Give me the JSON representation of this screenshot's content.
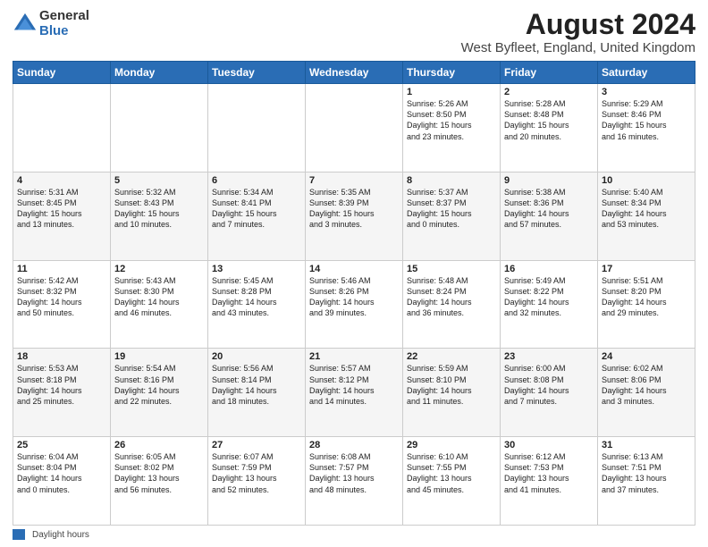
{
  "logo": {
    "general": "General",
    "blue": "Blue"
  },
  "title": "August 2024",
  "subtitle": "West Byfleet, England, United Kingdom",
  "footer": {
    "legend_label": "Daylight hours"
  },
  "headers": [
    "Sunday",
    "Monday",
    "Tuesday",
    "Wednesday",
    "Thursday",
    "Friday",
    "Saturday"
  ],
  "weeks": [
    [
      {
        "day": "",
        "info": ""
      },
      {
        "day": "",
        "info": ""
      },
      {
        "day": "",
        "info": ""
      },
      {
        "day": "",
        "info": ""
      },
      {
        "day": "1",
        "info": "Sunrise: 5:26 AM\nSunset: 8:50 PM\nDaylight: 15 hours\nand 23 minutes."
      },
      {
        "day": "2",
        "info": "Sunrise: 5:28 AM\nSunset: 8:48 PM\nDaylight: 15 hours\nand 20 minutes."
      },
      {
        "day": "3",
        "info": "Sunrise: 5:29 AM\nSunset: 8:46 PM\nDaylight: 15 hours\nand 16 minutes."
      }
    ],
    [
      {
        "day": "4",
        "info": "Sunrise: 5:31 AM\nSunset: 8:45 PM\nDaylight: 15 hours\nand 13 minutes."
      },
      {
        "day": "5",
        "info": "Sunrise: 5:32 AM\nSunset: 8:43 PM\nDaylight: 15 hours\nand 10 minutes."
      },
      {
        "day": "6",
        "info": "Sunrise: 5:34 AM\nSunset: 8:41 PM\nDaylight: 15 hours\nand 7 minutes."
      },
      {
        "day": "7",
        "info": "Sunrise: 5:35 AM\nSunset: 8:39 PM\nDaylight: 15 hours\nand 3 minutes."
      },
      {
        "day": "8",
        "info": "Sunrise: 5:37 AM\nSunset: 8:37 PM\nDaylight: 15 hours\nand 0 minutes."
      },
      {
        "day": "9",
        "info": "Sunrise: 5:38 AM\nSunset: 8:36 PM\nDaylight: 14 hours\nand 57 minutes."
      },
      {
        "day": "10",
        "info": "Sunrise: 5:40 AM\nSunset: 8:34 PM\nDaylight: 14 hours\nand 53 minutes."
      }
    ],
    [
      {
        "day": "11",
        "info": "Sunrise: 5:42 AM\nSunset: 8:32 PM\nDaylight: 14 hours\nand 50 minutes."
      },
      {
        "day": "12",
        "info": "Sunrise: 5:43 AM\nSunset: 8:30 PM\nDaylight: 14 hours\nand 46 minutes."
      },
      {
        "day": "13",
        "info": "Sunrise: 5:45 AM\nSunset: 8:28 PM\nDaylight: 14 hours\nand 43 minutes."
      },
      {
        "day": "14",
        "info": "Sunrise: 5:46 AM\nSunset: 8:26 PM\nDaylight: 14 hours\nand 39 minutes."
      },
      {
        "day": "15",
        "info": "Sunrise: 5:48 AM\nSunset: 8:24 PM\nDaylight: 14 hours\nand 36 minutes."
      },
      {
        "day": "16",
        "info": "Sunrise: 5:49 AM\nSunset: 8:22 PM\nDaylight: 14 hours\nand 32 minutes."
      },
      {
        "day": "17",
        "info": "Sunrise: 5:51 AM\nSunset: 8:20 PM\nDaylight: 14 hours\nand 29 minutes."
      }
    ],
    [
      {
        "day": "18",
        "info": "Sunrise: 5:53 AM\nSunset: 8:18 PM\nDaylight: 14 hours\nand 25 minutes."
      },
      {
        "day": "19",
        "info": "Sunrise: 5:54 AM\nSunset: 8:16 PM\nDaylight: 14 hours\nand 22 minutes."
      },
      {
        "day": "20",
        "info": "Sunrise: 5:56 AM\nSunset: 8:14 PM\nDaylight: 14 hours\nand 18 minutes."
      },
      {
        "day": "21",
        "info": "Sunrise: 5:57 AM\nSunset: 8:12 PM\nDaylight: 14 hours\nand 14 minutes."
      },
      {
        "day": "22",
        "info": "Sunrise: 5:59 AM\nSunset: 8:10 PM\nDaylight: 14 hours\nand 11 minutes."
      },
      {
        "day": "23",
        "info": "Sunrise: 6:00 AM\nSunset: 8:08 PM\nDaylight: 14 hours\nand 7 minutes."
      },
      {
        "day": "24",
        "info": "Sunrise: 6:02 AM\nSunset: 8:06 PM\nDaylight: 14 hours\nand 3 minutes."
      }
    ],
    [
      {
        "day": "25",
        "info": "Sunrise: 6:04 AM\nSunset: 8:04 PM\nDaylight: 14 hours\nand 0 minutes."
      },
      {
        "day": "26",
        "info": "Sunrise: 6:05 AM\nSunset: 8:02 PM\nDaylight: 13 hours\nand 56 minutes."
      },
      {
        "day": "27",
        "info": "Sunrise: 6:07 AM\nSunset: 7:59 PM\nDaylight: 13 hours\nand 52 minutes."
      },
      {
        "day": "28",
        "info": "Sunrise: 6:08 AM\nSunset: 7:57 PM\nDaylight: 13 hours\nand 48 minutes."
      },
      {
        "day": "29",
        "info": "Sunrise: 6:10 AM\nSunset: 7:55 PM\nDaylight: 13 hours\nand 45 minutes."
      },
      {
        "day": "30",
        "info": "Sunrise: 6:12 AM\nSunset: 7:53 PM\nDaylight: 13 hours\nand 41 minutes."
      },
      {
        "day": "31",
        "info": "Sunrise: 6:13 AM\nSunset: 7:51 PM\nDaylight: 13 hours\nand 37 minutes."
      }
    ]
  ]
}
